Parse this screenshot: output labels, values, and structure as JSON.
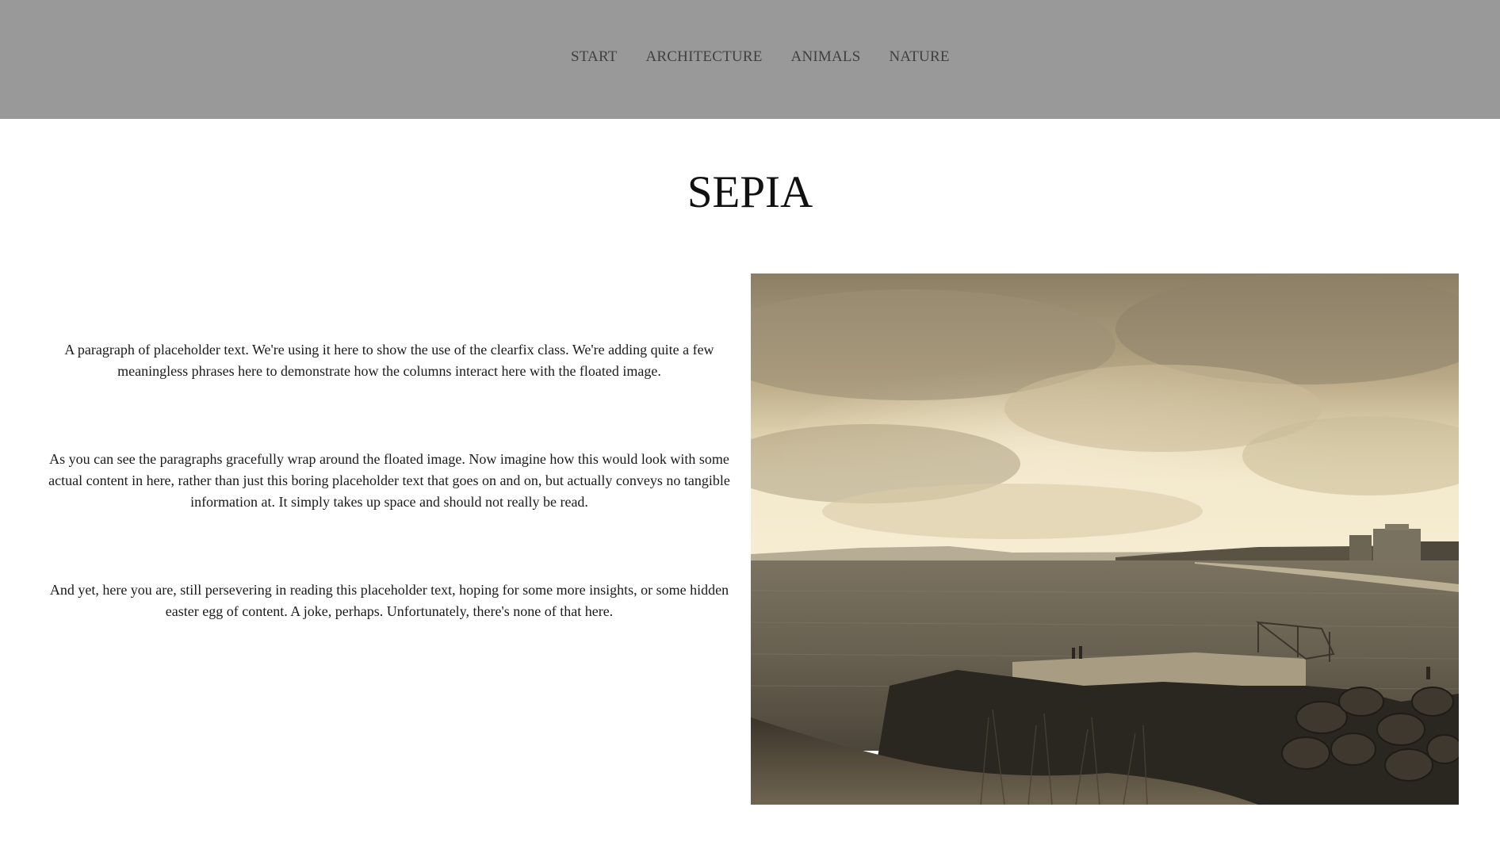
{
  "nav": {
    "items": [
      {
        "label": "START"
      },
      {
        "label": "ARCHITECTURE"
      },
      {
        "label": "ANIMALS"
      },
      {
        "label": "NATURE"
      }
    ]
  },
  "page": {
    "title": "SEPIA"
  },
  "content": {
    "paragraphs": [
      "A paragraph of placeholder text. We're using it here to show the use of the clearfix class. We're adding quite a few meaningless phrases here to demonstrate how the columns interact here with the floated image.",
      "As you can see the paragraphs gracefully wrap around the floated image. Now imagine how this would look with some actual content in here, rather than just this boring placeholder text that goes on and on, but actually conveys no tangible information at. It simply takes up space and should not really be read.",
      "And yet, here you are, still persevering in reading this placeholder text, hoping for some more insights, or some hidden easter egg of content. A joke, perhaps. Unfortunately, there's none of that here."
    ]
  },
  "image": {
    "description_icon": "sepia-seascape-photo",
    "tone_colors": {
      "sky_light": "#efe3c2",
      "sky_mid": "#b9a986",
      "sky_dark": "#7e735c",
      "sea": "#6b6353",
      "rock": "#2a2620",
      "grass": "#5e5440"
    }
  },
  "colors": {
    "header_bg": "#999999",
    "nav_text": "#404040",
    "page_bg": "#ffffff"
  }
}
